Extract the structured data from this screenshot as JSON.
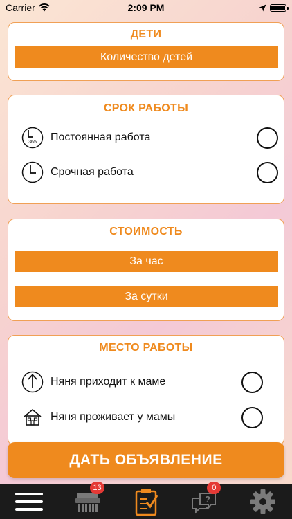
{
  "status_bar": {
    "carrier": "Carrier",
    "time": "2:09 PM"
  },
  "children_section": {
    "title": "ДЕТИ",
    "button_label": "Количество детей"
  },
  "work_term_section": {
    "title": "СРОК РАБОТЫ",
    "options": [
      {
        "label": "Постоянная работа",
        "icon": "calendar-365-clock-icon",
        "icon_text": "365"
      },
      {
        "label": "Срочная работа",
        "icon": "clock-icon"
      }
    ]
  },
  "cost_section": {
    "title": "СТОИМОСТЬ",
    "buttons": [
      "За час",
      "За сутки"
    ]
  },
  "workplace_section": {
    "title": "МЕСТО РАБОТЫ",
    "options": [
      {
        "label": "Няня приходит к маме",
        "icon": "arrival-up-icon"
      },
      {
        "label": "Няня проживает у мамы",
        "icon": "house-icon"
      }
    ]
  },
  "submit_label": "ДАТЬ ОБЪЯВЛЕНИЕ",
  "tab_bar": {
    "items": [
      {
        "name": "menu",
        "icon": "hamburger-menu-icon"
      },
      {
        "name": "ads",
        "icon": "shredder-list-icon",
        "badge": "13"
      },
      {
        "name": "new-ad",
        "icon": "clipboard-check-icon"
      },
      {
        "name": "messages",
        "icon": "chat-question-icon",
        "badge": "0"
      },
      {
        "name": "settings",
        "icon": "gear-icon"
      }
    ]
  },
  "colors": {
    "accent": "#ef8a1e",
    "tabbar": "#1b1b1b",
    "badge": "#e53935"
  }
}
